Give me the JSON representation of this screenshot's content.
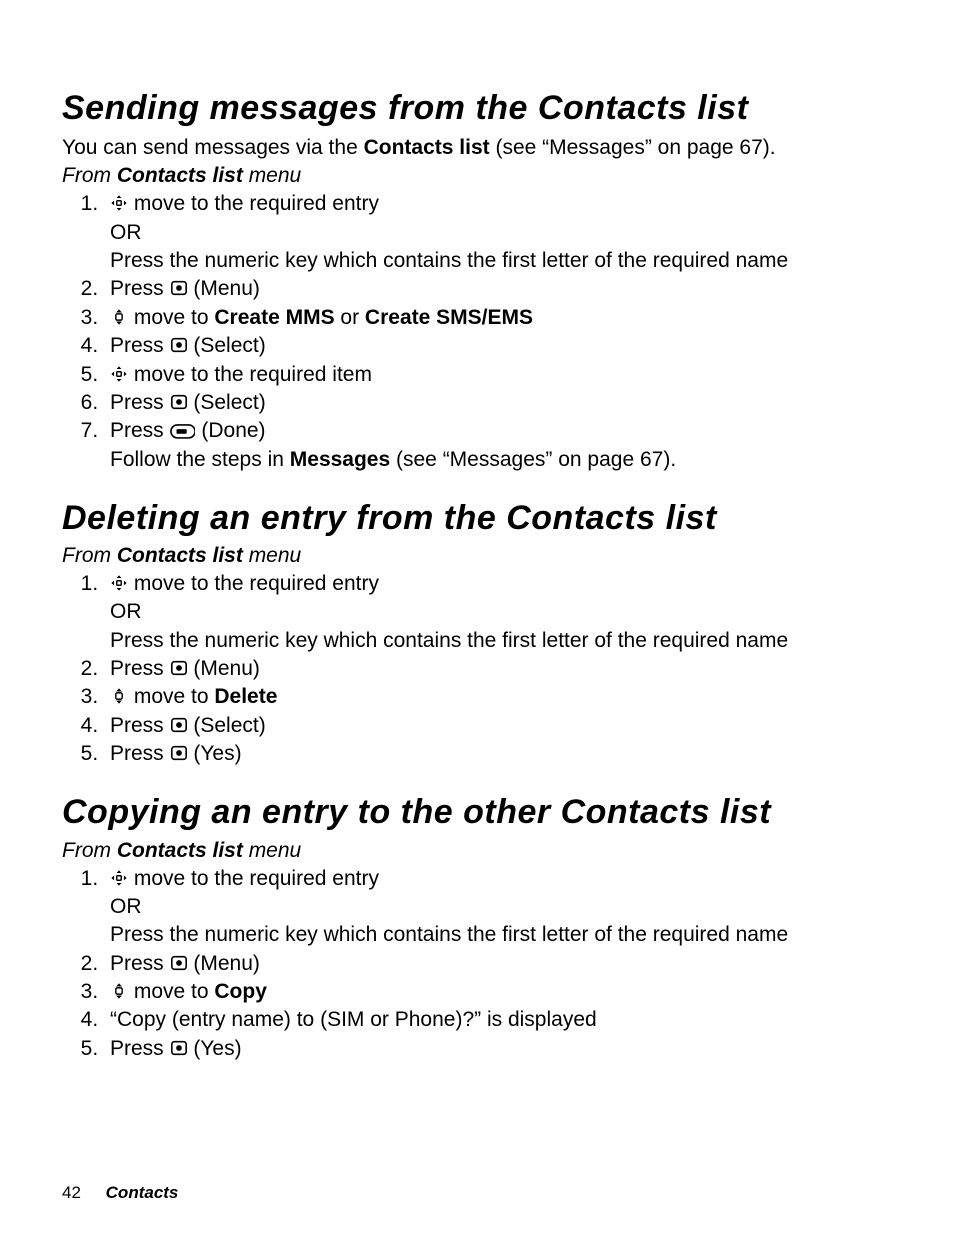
{
  "icons": {
    "nav4": "nav-4way-icon",
    "center": "center-key-icon",
    "nav2": "nav-updown-icon",
    "soft": "softkey-icon"
  },
  "section1": {
    "title": "Sending messages from the Contacts list",
    "intro_pre": "You can send messages via the ",
    "intro_bold": "Contacts list",
    "intro_post": " (see “Messages” on page 67).",
    "sub_pre": "From ",
    "sub_bold": "Contacts list",
    "sub_post": " menu",
    "s1a": " move to the required entry",
    "s1b": "OR",
    "s1c": "Press the numeric key which contains the first letter of the required name",
    "s2_pre": "Press ",
    "s2_post": " (Menu)",
    "s3_pre": " move to ",
    "s3_b1": "Create MMS",
    "s3_mid": " or ",
    "s3_b2": "Create SMS/EMS",
    "s4_pre": "Press ",
    "s4_post": " (Select)",
    "s5": " move to the required item",
    "s6_pre": "Press ",
    "s6_post": " (Select)",
    "s7_pre": "Press ",
    "s7_post": " (Done)",
    "s7b_pre": "Follow the steps in ",
    "s7b_bold": "Messages",
    "s7b_post": " (see “Messages” on page 67)."
  },
  "section2": {
    "title": "Deleting an entry from the Contacts list",
    "sub_pre": "From ",
    "sub_bold": "Contacts list",
    "sub_post": " menu",
    "s1a": " move to the required entry",
    "s1b": "OR",
    "s1c": "Press the numeric key which contains the first letter of the required name",
    "s2_pre": "Press ",
    "s2_post": " (Menu)",
    "s3_pre": " move to ",
    "s3_bold": "Delete",
    "s4_pre": "Press ",
    "s4_post": " (Select)",
    "s5_pre": "Press ",
    "s5_post": " (Yes)"
  },
  "section3": {
    "title": "Copying an entry to the other Contacts list",
    "sub_pre": "From ",
    "sub_bold": "Contacts list",
    "sub_post": " menu",
    "s1a": " move to the required entry",
    "s1b": "OR",
    "s1c": "Press the numeric key which contains the first letter of the required name",
    "s2_pre": "Press ",
    "s2_post": " (Menu)",
    "s3_pre": " move to ",
    "s3_bold": "Copy",
    "s4": "“Copy (entry name) to (SIM or Phone)?” is displayed",
    "s5_pre": "Press ",
    "s5_post": " (Yes)"
  },
  "footer": {
    "page": "42",
    "label": "Contacts"
  }
}
